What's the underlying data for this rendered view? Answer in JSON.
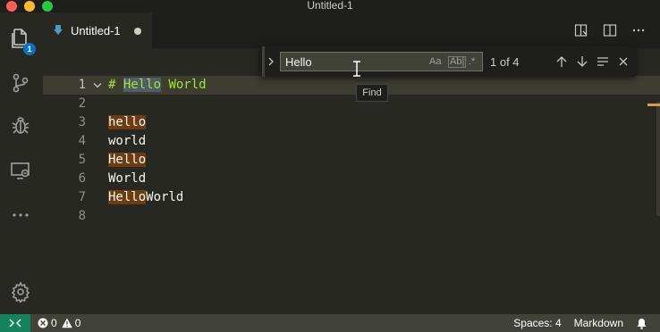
{
  "window": {
    "title": "Untitled-1"
  },
  "activity_bar": {
    "items": [
      {
        "name": "explorer",
        "icon": "files-icon",
        "badge": "1"
      },
      {
        "name": "source-control",
        "icon": "source-control-icon"
      },
      {
        "name": "debug",
        "icon": "bug-icon"
      },
      {
        "name": "remote-explorer",
        "icon": "remote-explorer-icon"
      },
      {
        "name": "more",
        "icon": "ellipsis-icon"
      }
    ],
    "settings_icon": "gear-icon"
  },
  "tabs": [
    {
      "label": "Untitled-1",
      "dirty": true,
      "active": true,
      "icon": "markdown-file-icon"
    }
  ],
  "editor": {
    "line_numbers": [
      "1",
      "2",
      "3",
      "4",
      "5",
      "6",
      "7",
      "8"
    ],
    "lines": [
      {
        "parts": [
          {
            "text": "# ",
            "style": "md-head"
          },
          {
            "text": "Hello",
            "style": "md-head hl-cur"
          },
          {
            "text": " World",
            "style": "md-head"
          }
        ]
      },
      {
        "parts": []
      },
      {
        "parts": [
          {
            "text": "hello",
            "style": "hl"
          }
        ]
      },
      {
        "parts": [
          {
            "text": "world",
            "style": ""
          }
        ]
      },
      {
        "parts": [
          {
            "text": "Hello",
            "style": "hl"
          }
        ]
      },
      {
        "parts": [
          {
            "text": "World",
            "style": ""
          }
        ]
      },
      {
        "parts": [
          {
            "text": "Hello",
            "style": "hl"
          },
          {
            "text": "World",
            "style": ""
          }
        ]
      },
      {
        "parts": []
      }
    ],
    "active_line": "1"
  },
  "find": {
    "value": "Hello",
    "match_case_label": "Aa",
    "whole_word_label": "Ab|",
    "regex_label": ".*",
    "match_count": "1 of 4",
    "tooltip": "Find"
  },
  "status_bar": {
    "errors": "0",
    "warnings": "0",
    "indent": "Spaces: 4",
    "language": "Markdown"
  },
  "colors": {
    "background": "#272822",
    "match_highlight": "#6e3c13",
    "heading": "#a6e22e",
    "badge": "#0e70c0",
    "status_bar": "#414339",
    "remote": "#16825d"
  }
}
